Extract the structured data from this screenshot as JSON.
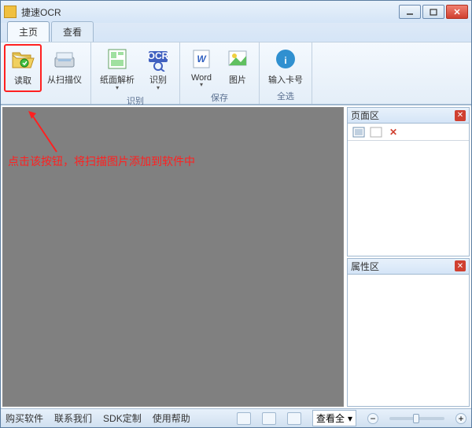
{
  "title": "捷速OCR",
  "tabs": [
    {
      "label": "主页",
      "active": true
    },
    {
      "label": "查看",
      "active": false
    }
  ],
  "ribbon": {
    "read": {
      "label": "读取"
    },
    "scanner": {
      "label": "从扫描仪"
    },
    "parse": {
      "label": "纸面解析"
    },
    "ocr": {
      "label": "识别"
    },
    "word": {
      "label": "Word"
    },
    "image": {
      "label": "图片"
    },
    "license": {
      "label": "输入卡号"
    },
    "groups": {
      "recognize": "识别",
      "save": "保存",
      "select_all": "全选"
    }
  },
  "annotation": "点击该按钮，将扫描图片添加到软件中",
  "panels": {
    "page": {
      "title": "页面区"
    },
    "prop": {
      "title": "属性区"
    }
  },
  "status": {
    "buy": "购买软件",
    "contact": "联系我们",
    "sdk": "SDK定制",
    "help": "使用帮助",
    "viewall": "查看全"
  }
}
